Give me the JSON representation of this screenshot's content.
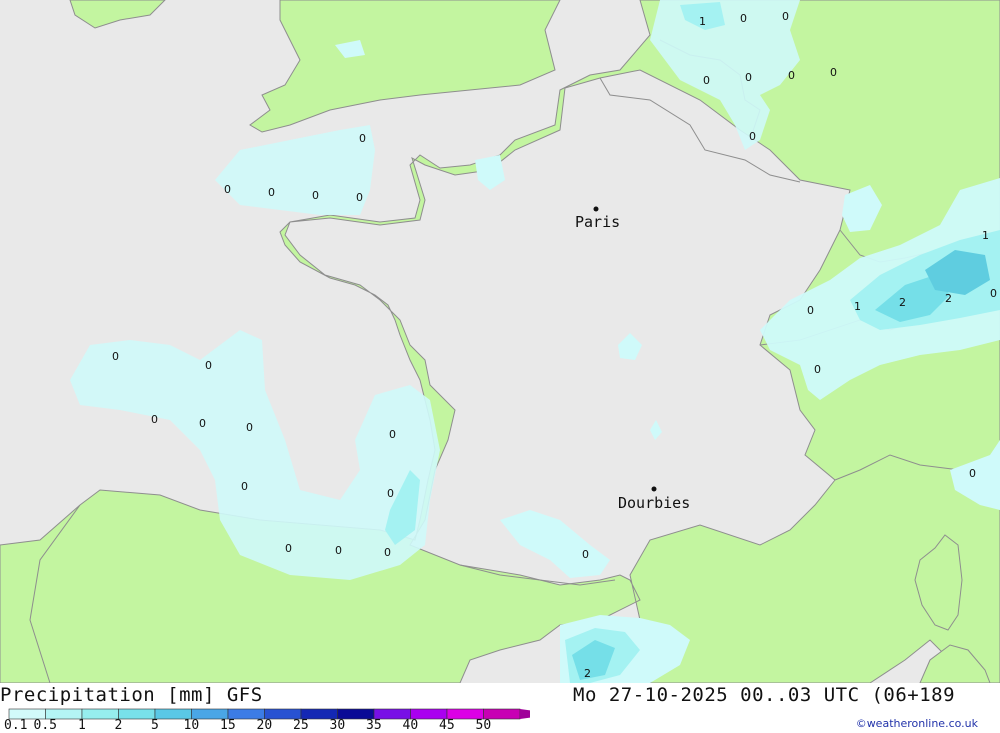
{
  "map": {
    "colors": {
      "sea": "#e9e9e9",
      "land": "#c3f5a0",
      "border": "#8e8e8e",
      "precip_light": "#cffafa",
      "precip_mid": "#a4f2f2",
      "precip_strong": "#75dfe8"
    },
    "cities": [
      {
        "name": "Paris"
      },
      {
        "name": "Dourbies"
      }
    ],
    "values": [
      "1",
      "0",
      "0",
      "0",
      "0",
      "0",
      "0",
      "0",
      "0",
      "0",
      "0",
      "0",
      "0",
      "0",
      "0",
      "0",
      "0",
      "0",
      "0",
      "0",
      "0",
      "0",
      "0",
      "0",
      "0",
      "0",
      "0",
      "1",
      "1",
      "2",
      "2",
      "0",
      "0",
      "0",
      "0",
      "2"
    ]
  },
  "footer": {
    "title": "Precipitation [mm] GFS",
    "datetime": "Mo 27-10-2025 00..03 UTC (06+189",
    "credit": "©weatheronline.co.uk",
    "legend": {
      "ticks": [
        "0.1",
        "0.5",
        "1",
        "2",
        "5",
        "10",
        "15",
        "20",
        "25",
        "30",
        "35",
        "40",
        "45",
        "50"
      ],
      "colors": [
        "#d2fafa",
        "#b4f5f5",
        "#96eeee",
        "#78e1ea",
        "#5ac8e6",
        "#4aa6e6",
        "#3c7ce6",
        "#2852d2",
        "#1428b4",
        "#0a0a96",
        "#7810e6",
        "#aa00f0",
        "#dc00e6",
        "#c800b4",
        "#a0009a"
      ]
    }
  }
}
